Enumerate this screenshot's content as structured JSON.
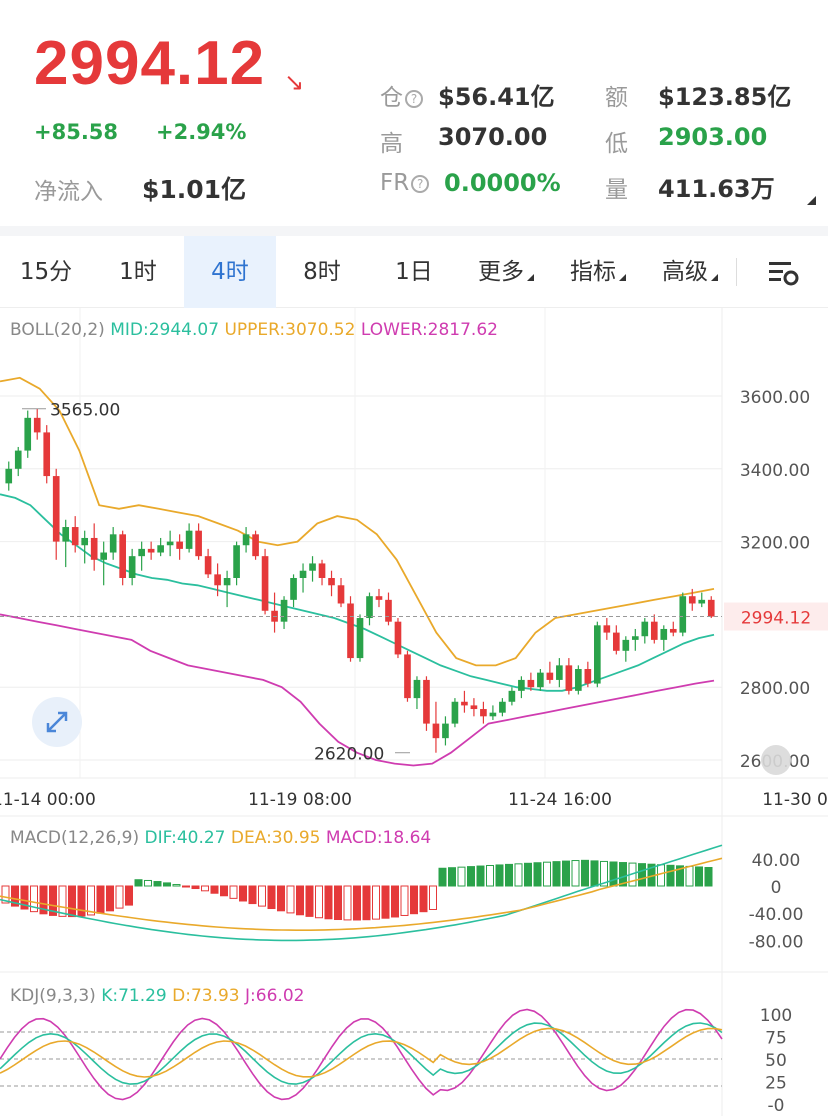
{
  "quote": {
    "last_price": "2994.12",
    "trend_icon": "down-right-arrow-icon",
    "change": "+85.58",
    "change_pct": "+2.94%",
    "net_inflow_label": "净流入",
    "net_inflow_value": "$1.01亿",
    "position_label": "仓",
    "position_value": "$56.41亿",
    "amount_label": "额",
    "amount_value": "$123.85亿",
    "high_label": "高",
    "high_value": "3070.00",
    "low_label": "低",
    "low_value": "2903.00",
    "fr_label": "FR",
    "fr_value": "0.0000%",
    "volume_label": "量",
    "volume_value": "411.63万"
  },
  "tabs": [
    {
      "label": "15分"
    },
    {
      "label": "1时"
    },
    {
      "label": "4时",
      "active": true
    },
    {
      "label": "8时"
    },
    {
      "label": "1日"
    },
    {
      "label": "更多"
    },
    {
      "label": "指标"
    },
    {
      "label": "高级"
    }
  ],
  "settings_icon": "chart-settings-icon",
  "colors": {
    "up": "#2aa24a",
    "down": "#e5393a",
    "mid": "#2bbf9e",
    "upper": "#e9a92b",
    "lower": "#cf3cb0"
  },
  "boll": {
    "label": "BOLL(20,2)",
    "mid": "MID:2944.07",
    "upper": "UPPER:3070.52",
    "lower": "LOWER:2817.62"
  },
  "price_axis": [
    "3600.00",
    "3400.00",
    "3200.00",
    "2800.00",
    "2600.00"
  ],
  "current_price_tag": "2994.12",
  "high_marker": "3565.00",
  "low_marker": "2620.00",
  "time_axis": [
    "11-14 00:00",
    "11-19 08:00",
    "11-24 16:00",
    "11-30 0"
  ],
  "macd": {
    "label": "MACD(12,26,9)",
    "dif": "DIF:40.27",
    "dea": "DEA:30.95",
    "macd": "MACD:18.64",
    "axis": [
      "40.00",
      "0",
      "-40.00",
      "-80.00"
    ]
  },
  "kdj": {
    "label": "KDJ(9,3,3)",
    "k": "K:71.29",
    "d": "D:73.93",
    "j": "J:66.02",
    "axis": [
      "100",
      "75",
      "50",
      "25",
      "-0"
    ]
  },
  "chart_data": {
    "type": "candlestick",
    "y_range": [
      2550,
      3700
    ],
    "candles_ohlc": [
      [
        3360,
        3420,
        3340,
        3400
      ],
      [
        3400,
        3460,
        3380,
        3450
      ],
      [
        3450,
        3560,
        3430,
        3540
      ],
      [
        3540,
        3565,
        3480,
        3500
      ],
      [
        3500,
        3520,
        3360,
        3380
      ],
      [
        3380,
        3400,
        3150,
        3200
      ],
      [
        3200,
        3260,
        3130,
        3240
      ],
      [
        3240,
        3270,
        3170,
        3190
      ],
      [
        3190,
        3230,
        3140,
        3210
      ],
      [
        3210,
        3250,
        3120,
        3150
      ],
      [
        3150,
        3200,
        3080,
        3170
      ],
      [
        3170,
        3240,
        3150,
        3220
      ],
      [
        3220,
        3230,
        3080,
        3100
      ],
      [
        3100,
        3180,
        3080,
        3160
      ],
      [
        3160,
        3200,
        3120,
        3180
      ],
      [
        3180,
        3200,
        3150,
        3170
      ],
      [
        3170,
        3210,
        3160,
        3190
      ],
      [
        3190,
        3230,
        3160,
        3200
      ],
      [
        3200,
        3220,
        3150,
        3180
      ],
      [
        3180,
        3250,
        3170,
        3230
      ],
      [
        3230,
        3250,
        3150,
        3160
      ],
      [
        3160,
        3180,
        3100,
        3110
      ],
      [
        3110,
        3140,
        3050,
        3080
      ],
      [
        3080,
        3120,
        3020,
        3100
      ],
      [
        3100,
        3200,
        3080,
        3190
      ],
      [
        3190,
        3240,
        3170,
        3220
      ],
      [
        3220,
        3230,
        3150,
        3160
      ],
      [
        3160,
        3180,
        3000,
        3010
      ],
      [
        3010,
        3060,
        2950,
        2980
      ],
      [
        2980,
        3050,
        2960,
        3040
      ],
      [
        3040,
        3110,
        3020,
        3100
      ],
      [
        3100,
        3140,
        3060,
        3120
      ],
      [
        3120,
        3160,
        3090,
        3140
      ],
      [
        3140,
        3150,
        3080,
        3100
      ],
      [
        3100,
        3120,
        3050,
        3080
      ],
      [
        3080,
        3100,
        3020,
        3030
      ],
      [
        3030,
        3050,
        2870,
        2880
      ],
      [
        2880,
        3000,
        2870,
        2990
      ],
      [
        2990,
        3060,
        2970,
        3050
      ],
      [
        3050,
        3070,
        3020,
        3040
      ],
      [
        3040,
        3060,
        2970,
        2980
      ],
      [
        2980,
        2990,
        2880,
        2890
      ],
      [
        2890,
        2900,
        2760,
        2770
      ],
      [
        2770,
        2830,
        2740,
        2820
      ],
      [
        2820,
        2830,
        2680,
        2700
      ],
      [
        2700,
        2760,
        2620,
        2660
      ],
      [
        2660,
        2720,
        2640,
        2700
      ],
      [
        2700,
        2770,
        2690,
        2760
      ],
      [
        2760,
        2790,
        2730,
        2750
      ],
      [
        2750,
        2770,
        2720,
        2740
      ],
      [
        2740,
        2760,
        2700,
        2720
      ],
      [
        2720,
        2750,
        2710,
        2730
      ],
      [
        2730,
        2770,
        2720,
        2760
      ],
      [
        2760,
        2800,
        2750,
        2790
      ],
      [
        2790,
        2830,
        2770,
        2820
      ],
      [
        2820,
        2840,
        2790,
        2800
      ],
      [
        2800,
        2850,
        2790,
        2840
      ],
      [
        2840,
        2870,
        2810,
        2820
      ],
      [
        2820,
        2880,
        2800,
        2860
      ],
      [
        2860,
        2880,
        2780,
        2790
      ],
      [
        2790,
        2860,
        2780,
        2850
      ],
      [
        2850,
        2870,
        2800,
        2810
      ],
      [
        2810,
        2980,
        2800,
        2970
      ],
      [
        2970,
        2990,
        2930,
        2950
      ],
      [
        2950,
        2970,
        2890,
        2900
      ],
      [
        2900,
        2940,
        2870,
        2930
      ],
      [
        2930,
        2960,
        2900,
        2940
      ],
      [
        2940,
        2990,
        2920,
        2980
      ],
      [
        2980,
        3000,
        2920,
        2930
      ],
      [
        2930,
        2970,
        2900,
        2960
      ],
      [
        2960,
        2980,
        2940,
        2950
      ],
      [
        2950,
        3060,
        2940,
        3050
      ],
      [
        3050,
        3070,
        3010,
        3030
      ],
      [
        3030,
        3060,
        3020,
        3040
      ],
      [
        3040,
        3050,
        2990,
        2994
      ]
    ],
    "mid": [
      3330,
      3320,
      3300,
      3260,
      3220,
      3190,
      3160,
      3140,
      3125,
      3110,
      3100,
      3095,
      3085,
      3080,
      3070,
      3060,
      3050,
      3040,
      3030,
      3020,
      3010,
      3000,
      2990,
      2975,
      2960,
      2940,
      2920,
      2900,
      2880,
      2860,
      2845,
      2830,
      2820,
      2810,
      2800,
      2795,
      2790,
      2790,
      2800,
      2815,
      2830,
      2845,
      2860,
      2880,
      2900,
      2920,
      2935,
      2944
    ],
    "upper": [
      3640,
      3650,
      3620,
      3560,
      3450,
      3300,
      3290,
      3300,
      3290,
      3280,
      3270,
      3250,
      3230,
      3200,
      3190,
      3200,
      3250,
      3270,
      3260,
      3220,
      3150,
      3050,
      2950,
      2880,
      2860,
      2860,
      2880,
      2950,
      2990,
      3000,
      3010,
      3020,
      3030,
      3040,
      3050,
      3060,
      3070
    ],
    "lower": [
      3000,
      2990,
      2980,
      2970,
      2960,
      2950,
      2940,
      2930,
      2900,
      2880,
      2860,
      2850,
      2840,
      2830,
      2820,
      2800,
      2760,
      2700,
      2650,
      2620,
      2600,
      2590,
      2585,
      2590,
      2620,
      2660,
      2700,
      2710,
      2720,
      2730,
      2740,
      2750,
      2760,
      2770,
      2780,
      2790,
      2800,
      2810,
      2818
    ]
  }
}
